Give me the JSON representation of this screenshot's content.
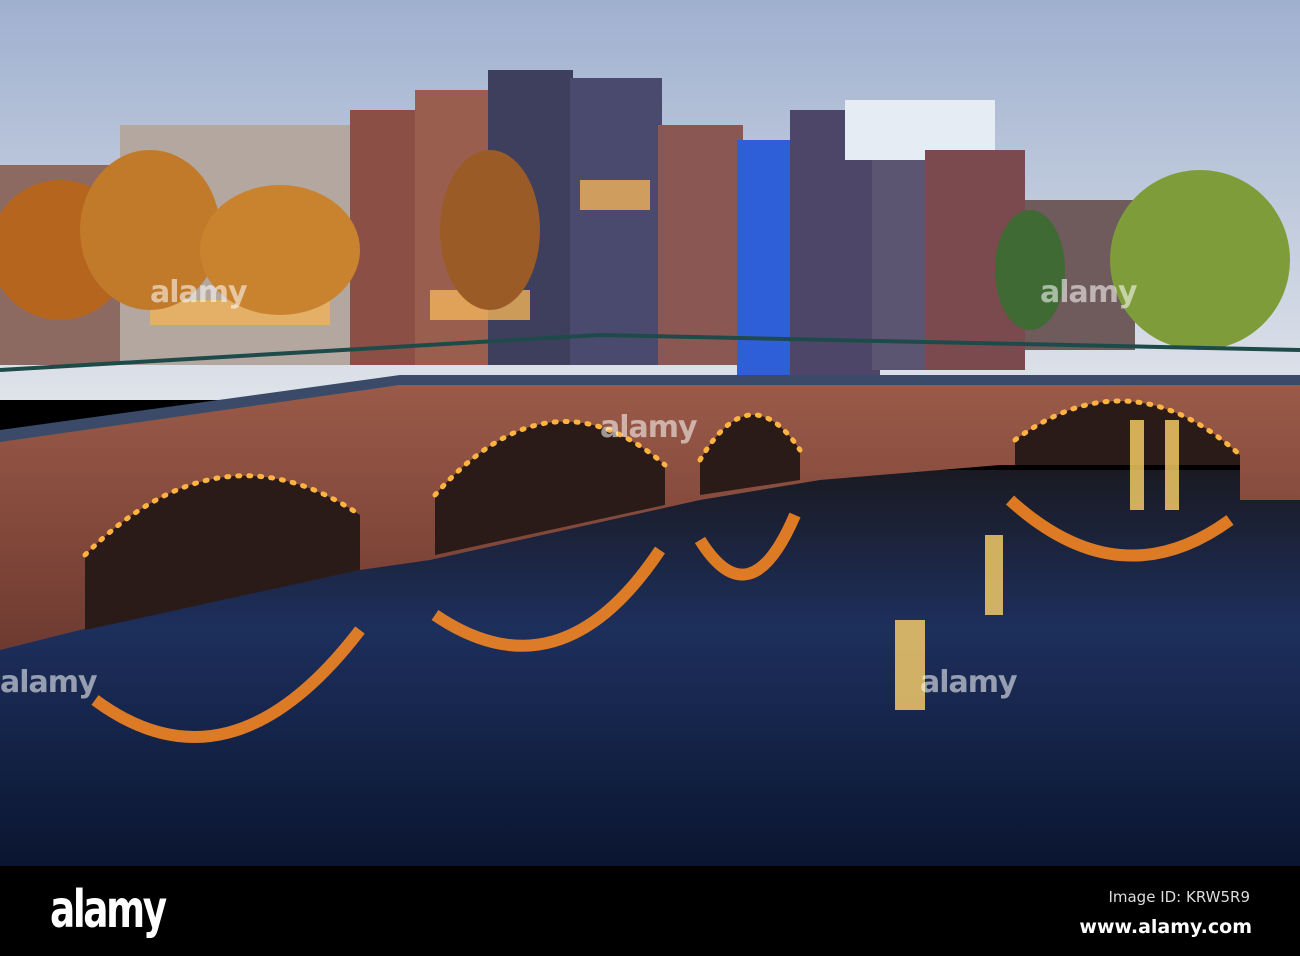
{
  "watermark": {
    "text": "alamy"
  },
  "footer": {
    "logo": "alamy",
    "image_id": "Image ID: KRW5R9",
    "website": "www.alamy.com"
  },
  "colors": {
    "sky_top": "#9fb0cf",
    "sky_bottom": "#dfe3ea",
    "water": "#0d1c3e",
    "brick": "#8a4a3c",
    "lights": "#ffb340"
  }
}
